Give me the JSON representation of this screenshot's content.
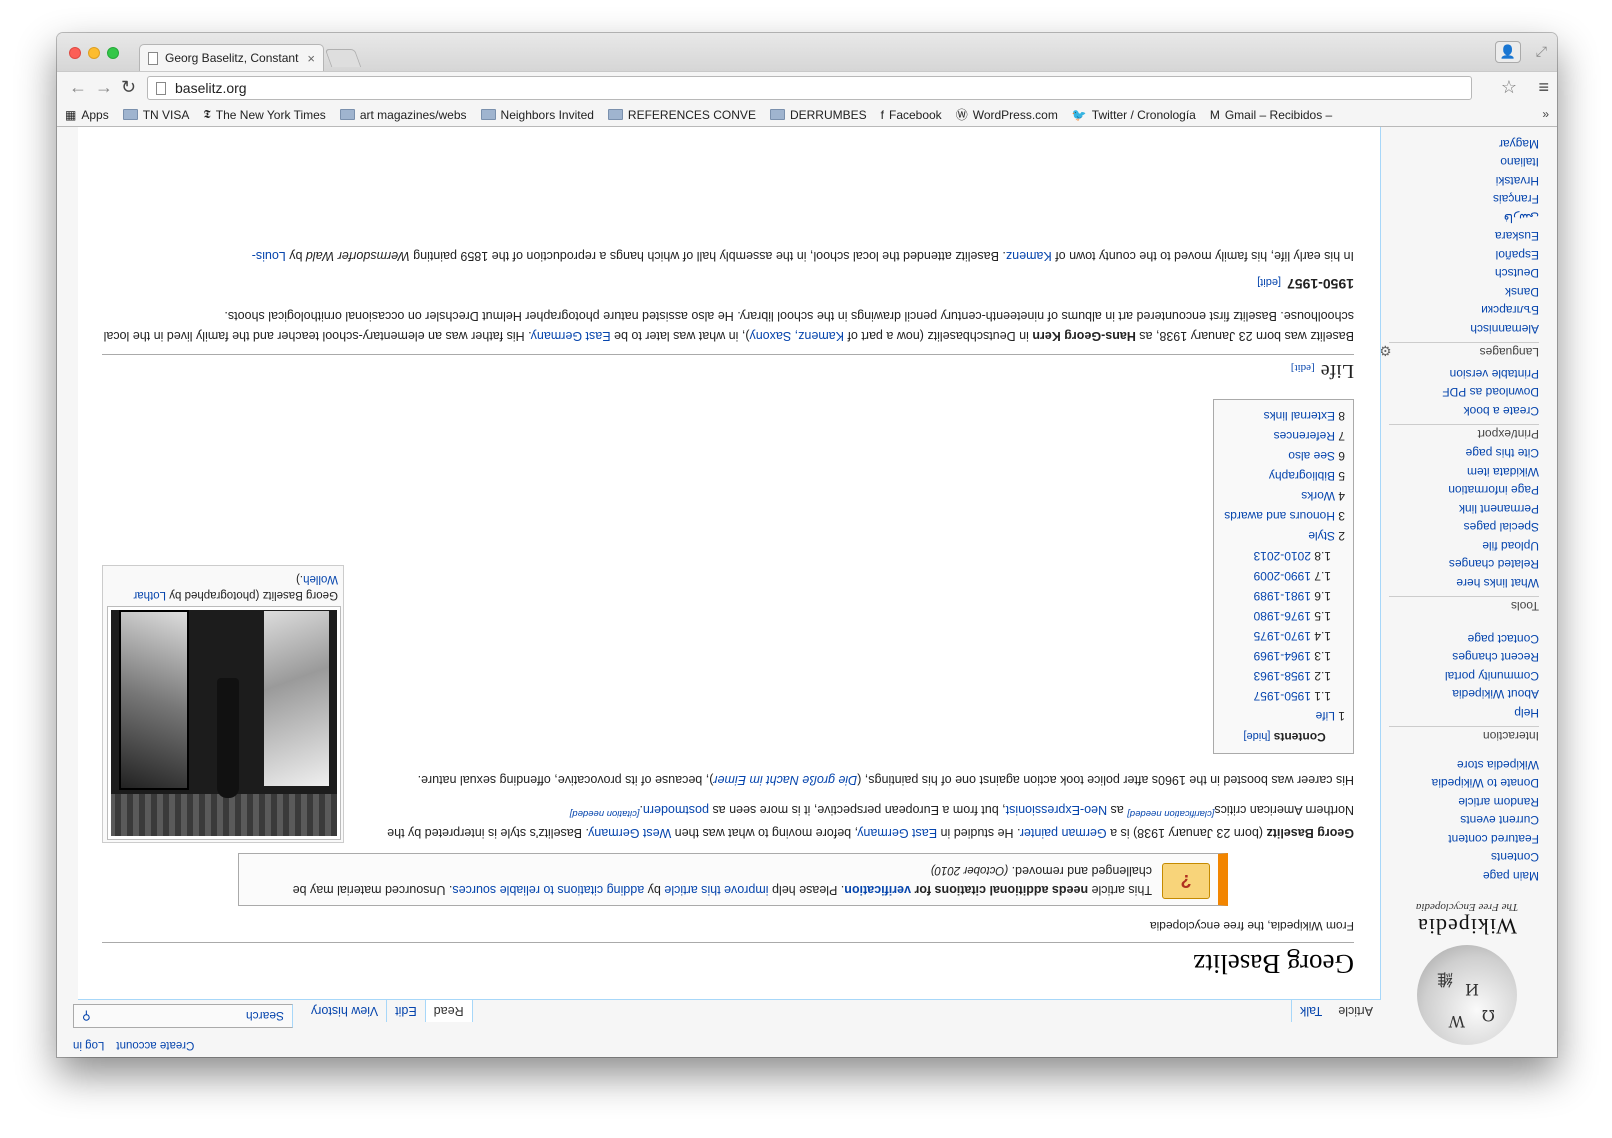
{
  "browser": {
    "tab_title": "Georg Baselitz, Constant D",
    "tab_close": "×",
    "url": "baselitz.org",
    "back": "←",
    "forward": "→",
    "reload": "↻",
    "star": "☆",
    "menu": "≡",
    "bookmarks": [
      {
        "label": "Apps",
        "kind": "apps"
      },
      {
        "label": "TN VISA",
        "kind": "folder"
      },
      {
        "label": "The New York Times",
        "kind": "nyt"
      },
      {
        "label": "art magazines/webs",
        "kind": "folder"
      },
      {
        "label": "Neighbors Invited",
        "kind": "folder"
      },
      {
        "label": "REFERENCES CONVE",
        "kind": "folder"
      },
      {
        "label": "DERRUMBES",
        "kind": "folder"
      },
      {
        "label": "Facebook",
        "kind": "facebook"
      },
      {
        "label": "WordPress.com",
        "kind": "wordpress"
      },
      {
        "label": "Twitter / Cronología",
        "kind": "twitter"
      },
      {
        "label": "Gmail – Recibidos –",
        "kind": "gmail"
      }
    ],
    "bookmarks_more": "»"
  },
  "wiki": {
    "wordmark": "Wikipedia",
    "tagline": "The Free Encyclopedia",
    "personal": [
      "Create account",
      "Log in"
    ],
    "tabs_left": [
      {
        "label": "Article",
        "selected": true
      },
      {
        "label": "Talk",
        "selected": false
      }
    ],
    "tabs_right": [
      {
        "label": "Read",
        "selected": true
      },
      {
        "label": "Edit",
        "selected": false
      },
      {
        "label": "View history",
        "selected": false
      }
    ],
    "search_placeholder": "Search",
    "nav_main": [
      "Main page",
      "Contents",
      "Featured content",
      "Current events",
      "Random article",
      "Donate to Wikipedia",
      "Wikipedia store"
    ],
    "interaction": {
      "heading": "Interaction",
      "items": [
        "Help",
        "About Wikipedia",
        "Community portal",
        "Recent changes",
        "Contact page"
      ]
    },
    "tools": {
      "heading": "Tools",
      "items": [
        "What links here",
        "Related changes",
        "Upload file",
        "Special pages",
        "Permanent link",
        "Page information",
        "Wikidata item",
        "Cite this page"
      ]
    },
    "print": {
      "heading": "Print/export",
      "items": [
        "Create a book",
        "Download as PDF",
        "Printable version"
      ]
    },
    "languages": {
      "heading": "Languages",
      "items": [
        "Alemannisch",
        "Български",
        "Dansk",
        "Deutsch",
        "Español",
        "Euskara",
        "فارسی",
        "Français",
        "Hrvatski",
        "Italiano",
        "Magyar"
      ]
    },
    "article": {
      "title": "Georg Baselitz",
      "from": "From Wikipedia, the free encyclopedia",
      "ambox_text_a": "This article ",
      "ambox_bold": "needs additional citations for ",
      "ambox_link_verif": "verification",
      "ambox_text_b": ". Please help ",
      "ambox_link_improve": "improve this article",
      "ambox_text_c": " by ",
      "ambox_link_adding": "adding citations to reliable sources",
      "ambox_text_d": ". Unsourced material may be challenged and removed. ",
      "ambox_date": "(October 2010)",
      "lead_bold": "Georg Baselitz",
      "lead_1": " (born 23 January 1938) is a ",
      "lead_link_painter": "German painter",
      "lead_2": ". He studied in ",
      "lead_link_eg": "East Germany",
      "lead_3": ", before moving to what was then ",
      "lead_link_wg": "West Germany",
      "lead_4": ". Baselitz's style is interpreted by the Northern American critics",
      "cite_clar": "[clarification needed]",
      "lead_5": " as ",
      "lead_link_neo": "Neo-Expressionist",
      "lead_6": ", but from a European perspective, it is more seen as ",
      "lead_link_post": "postmodern",
      "lead_7": ".",
      "cite_needed": "[citation needed]",
      "career_1": "His career was boosted in the 1960s after police took action against one of his paintings, (",
      "career_link": "Die große Nacht im Eimer",
      "career_2": "), because of its provocative, offending sexual nature.",
      "infobox_caption": "Georg Baselitz (photographed by ",
      "infobox_caption_link": "Lothar Wolleh",
      "infobox_caption_end": ".)",
      "toc_title": "Contents",
      "toc_hide": "[hide]",
      "toc": [
        {
          "num": "1",
          "label": "Life",
          "level": 1
        },
        {
          "num": "1.1",
          "label": "1950-1957",
          "level": 2
        },
        {
          "num": "1.2",
          "label": "1958-1963",
          "level": 2
        },
        {
          "num": "1.3",
          "label": "1964-1969",
          "level": 2
        },
        {
          "num": "1.4",
          "label": "1970-1975",
          "level": 2
        },
        {
          "num": "1.5",
          "label": "1976-1980",
          "level": 2
        },
        {
          "num": "1.6",
          "label": "1981-1989",
          "level": 2
        },
        {
          "num": "1.7",
          "label": "1990-2009",
          "level": 2
        },
        {
          "num": "1.8",
          "label": "2010-2013",
          "level": 2
        },
        {
          "num": "2",
          "label": "Style",
          "level": 1
        },
        {
          "num": "3",
          "label": "Honours and awards",
          "level": 1
        },
        {
          "num": "4",
          "label": "Works",
          "level": 1
        },
        {
          "num": "5",
          "label": "Bibliography",
          "level": 1
        },
        {
          "num": "6",
          "label": "See also",
          "level": 1
        },
        {
          "num": "7",
          "label": "References",
          "level": 1
        },
        {
          "num": "8",
          "label": "External links",
          "level": 1
        }
      ],
      "life_heading": "Life",
      "edit": "[edit]",
      "life_1": "Baselitz was born 23 January 1938, as ",
      "life_bold": "Hans-Georg Kern",
      "life_2": " in Deutschbaselitz (now a part of ",
      "life_link_kamenz": "Kamenz, Saxony",
      "life_3": "), in what was later to be ",
      "life_link_eg": "East Germany",
      "life_4": ". His father was an elementary-school teacher and the family lived in the local schoolhouse. Baselitz first encountered art in albums of nineteenth-century pencil drawings in the school library. He also assisted nature photographer Helmut Drechsler on occasional ornithological shoots.",
      "sub_heading": "1950-1957",
      "sub_1": "In his early life, his family moved to the county town of ",
      "sub_link": "Kamenz",
      "sub_2": ". Baselitz attended the local school, in the assembly hall of which hangs a reproduction of the 1859 painting ",
      "sub_italic": "Wermsdorfer Wald",
      "sub_3": " by ",
      "sub_link2": "Louis-"
    }
  }
}
